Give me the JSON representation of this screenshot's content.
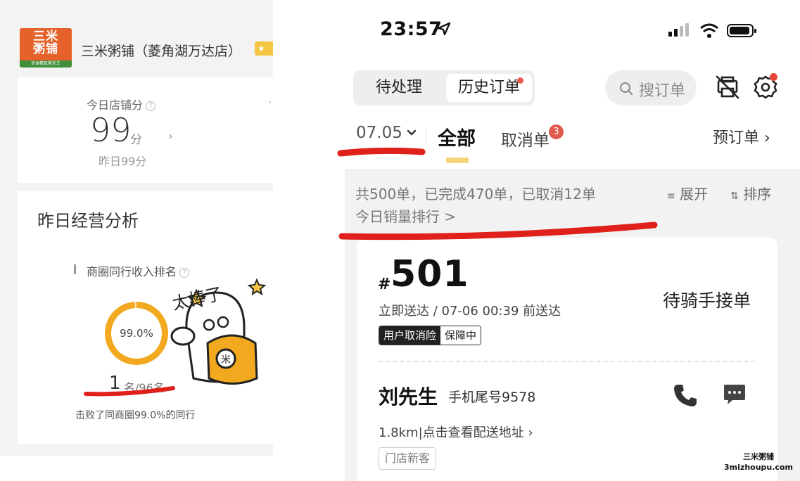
{
  "left_panel": {
    "store": {
      "logo_text": "三米\n粥铺",
      "logo_tagline": "良食精真粥天王",
      "name": "三米粥铺（菱角湖万达店）",
      "badge": "★"
    },
    "score": {
      "label": "今日店铺分",
      "help": "?",
      "value": "99",
      "unit": "分",
      "arrow": "›",
      "yesterday": "昨日99分"
    },
    "analysis": {
      "title": "昨日经营分析",
      "rank_label": "商圈同行收入排名",
      "rank_percent": "99.0%",
      "rank_percent_value": 99.0,
      "rank_value": "1",
      "rank_of": "名/96名",
      "beat_text": "击败了同商圈99.0%的同行"
    },
    "sticker_text": "太棒了"
  },
  "status_bar": {
    "time": "23:57"
  },
  "header": {
    "tabs": [
      {
        "label": "待处理",
        "active": false
      },
      {
        "label": "历史订单",
        "active": true
      }
    ],
    "search_placeholder": "搜订单"
  },
  "filter": {
    "date": "07.05",
    "tab_all": "全部",
    "tab_cancel": "取消单",
    "cancel_badge": "3",
    "preorder": "预订单 ›"
  },
  "summary": {
    "line": "共500单，已完成470单，已取消12单",
    "expand": "展开",
    "sort": "排序",
    "rank_link": "今日销量排行 >"
  },
  "order": {
    "hash": "#",
    "number": "501",
    "status": "待骑手接单",
    "delivery": "立即送达 / 07-06 00:39 前送达",
    "tag_insurance": "用户取消险",
    "tag_protect": "保障中",
    "customer_name": "刘先生",
    "customer_phone": "手机尾号9578",
    "distance": "1.8km|点击查看配送地址 ›",
    "new_customer_tag": "门店新客"
  },
  "watermark": {
    "line1": "三米粥铺",
    "line2": "3mizhoupu.com"
  },
  "colors": {
    "accent_orange": "#f2a81f",
    "badge_red": "#e25a4d",
    "marker_red": "#e0201a",
    "tab_underline": "#f6d57a"
  }
}
